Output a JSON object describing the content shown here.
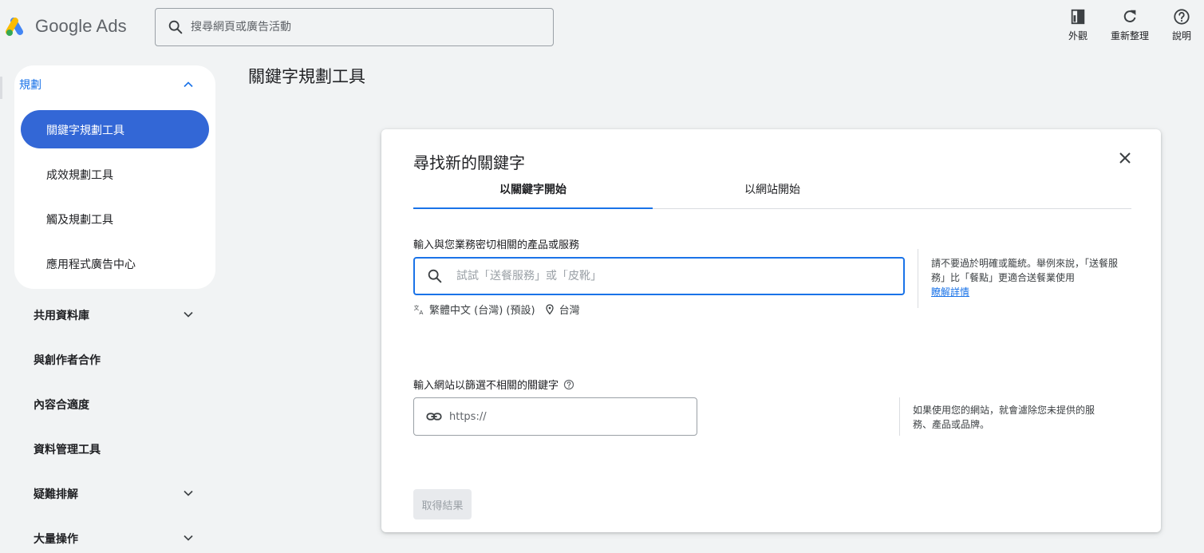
{
  "app": {
    "logo_text": "Google Ads",
    "search_placeholder": "搜尋網頁或廣告活動"
  },
  "toolbar": {
    "appearance_label": "外觀",
    "refresh_label": "重新整理",
    "help_label": "說明"
  },
  "sidebar": {
    "section_title": "規劃",
    "items": [
      {
        "label": "關鍵字規劃工具",
        "active": true
      },
      {
        "label": "成效規劃工具"
      },
      {
        "label": "觸及規劃工具"
      },
      {
        "label": "應用程式廣告中心"
      }
    ],
    "sections": [
      {
        "label": "共用資料庫",
        "expandable": true
      },
      {
        "label": "與創作者合作",
        "expandable": false
      },
      {
        "label": "內容合適度",
        "expandable": false
      },
      {
        "label": "資料管理工具",
        "expandable": false
      },
      {
        "label": "疑難排解",
        "expandable": true
      },
      {
        "label": "大量操作",
        "expandable": true
      }
    ]
  },
  "main": {
    "page_title": "關鍵字規劃工具"
  },
  "dialog": {
    "title": "尋找新的關鍵字",
    "tabs": [
      {
        "label": "以關鍵字開始",
        "active": true
      },
      {
        "label": "以網站開始",
        "active": false
      }
    ],
    "keyword_section": {
      "label": "輸入與您業務密切相關的產品或服務",
      "placeholder": "試試「送餐服務」或「皮靴」",
      "language": "繁體中文 (台灣) (預設)",
      "location": "台灣",
      "hint": "請不要過於明確或籠統。舉例來說，「送餐服務」比「餐點」更適合送餐業使用",
      "learn_more": "瞭解詳情"
    },
    "website_section": {
      "label": "輸入網站以篩選不相關的關鍵字",
      "placeholder": "https://",
      "hint": "如果使用您的網站，就會濾除您未提供的服務、產品或品牌。"
    },
    "submit_label": "取得結果"
  },
  "colors": {
    "accent": "#1a73e8",
    "active_nav": "#3367d6",
    "background": "#f1f3f4"
  }
}
